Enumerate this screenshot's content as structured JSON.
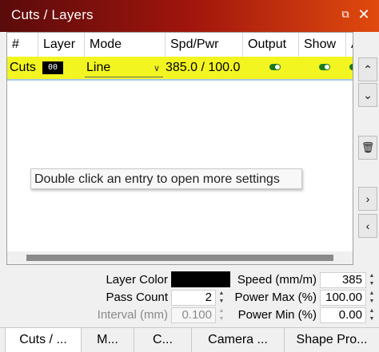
{
  "window": {
    "title": "Cuts / Layers",
    "float_icon": "float-window-icon",
    "close_icon": "close-icon"
  },
  "grid": {
    "columns": [
      "#",
      "Layer",
      "Mode",
      "Spd/Pwr",
      "Output",
      "Show",
      "A"
    ],
    "rows": [
      {
        "name": "Cuts",
        "layer": "00",
        "mode": "Line",
        "spd_pwr": "385.0 / 100.0",
        "output": true,
        "show": true,
        "air": true
      }
    ],
    "tooltip": "Double click an entry to open more settings"
  },
  "right_buttons": [
    {
      "icon": "chevron-up-icon",
      "glyph": "^"
    },
    {
      "icon": "chevron-down-icon",
      "glyph": "⌄"
    },
    {
      "icon": "trash-icon",
      "glyph": "🗑"
    },
    {
      "icon": "chevron-right-icon",
      "glyph": ">"
    },
    {
      "icon": "chevron-left-icon",
      "glyph": "<"
    }
  ],
  "properties": {
    "layer_color_label": "Layer Color",
    "pass_count_label": "Pass Count",
    "pass_count_value": "2",
    "interval_label": "Interval (mm)",
    "interval_value": "0.100",
    "speed_label": "Speed (mm/m)",
    "speed_value": "385",
    "power_max_label": "Power Max (%)",
    "power_max_value": "100.00",
    "power_min_label": "Power Min (%)",
    "power_min_value": "0.00",
    "layer_color": "#000000"
  },
  "tabs": [
    "Cuts / ...",
    "M...",
    "C...",
    "Camera ...",
    "Shape Pro..."
  ],
  "colors": {
    "title_gradient": [
      "#5a0b0b",
      "#e04a0e"
    ],
    "highlight": "#f2f520",
    "toggle_on": "#1a7a1a"
  }
}
